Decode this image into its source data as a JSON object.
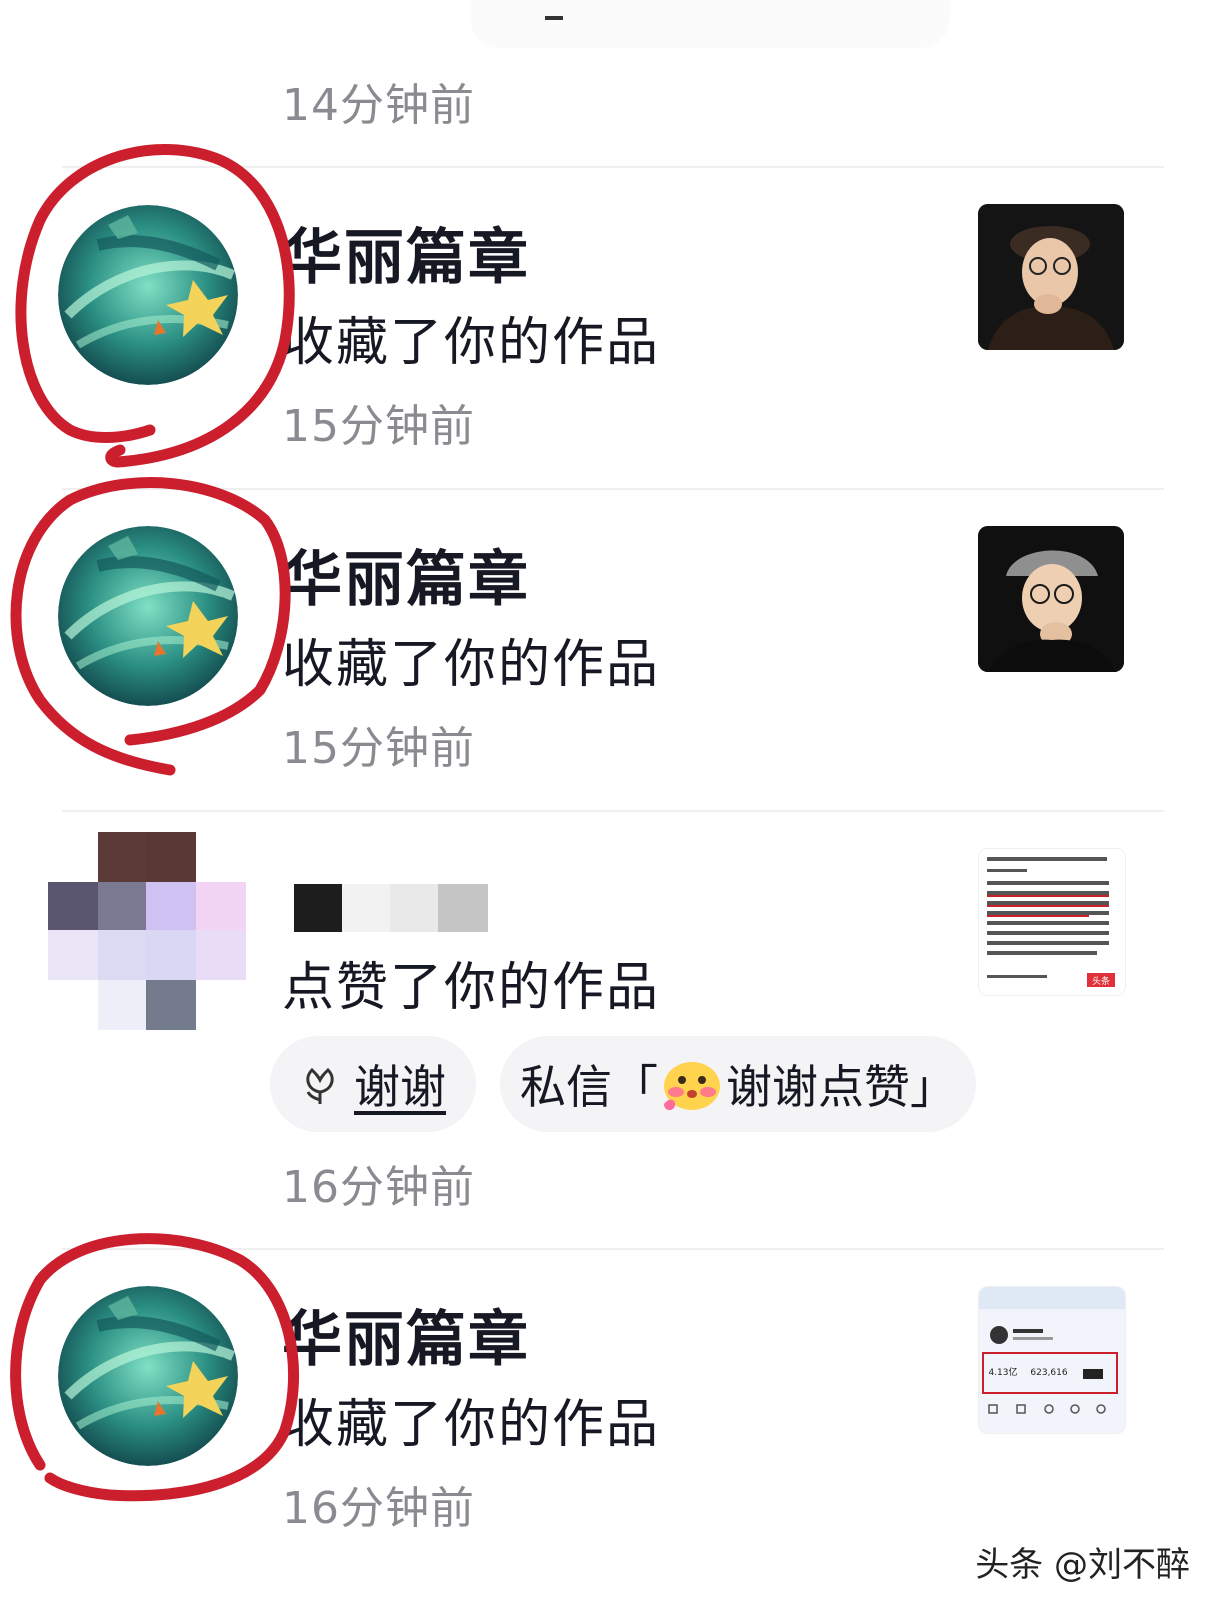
{
  "notifications": [
    {
      "time": "14分钟前"
    },
    {
      "user": "华丽篇章",
      "action": "收藏了你的作品",
      "time": "15分钟前",
      "avatar_icon": "game-emblem-avatar-icon",
      "thumb_icon": "man-portrait-thumbnail"
    },
    {
      "user": "华丽篇章",
      "action": "收藏了你的作品",
      "time": "15分钟前",
      "avatar_icon": "game-emblem-avatar-icon",
      "thumb_icon": "man-portrait-thumbnail"
    },
    {
      "user": "",
      "action": "点赞了你的作品",
      "time": "16分钟前",
      "avatar_icon": "pixelated-avatar",
      "thumb_icon": "article-screenshot-thumbnail",
      "thumb_badge": "头条",
      "buttons": {
        "thanks": "谢谢",
        "dm_prefix": "私信「",
        "dm_text": "谢谢点赞」"
      }
    },
    {
      "user": "华丽篇章",
      "action": "收藏了你的作品",
      "time": "16分钟前",
      "avatar_icon": "game-emblem-avatar-icon",
      "thumb_icon": "profile-stats-screenshot-thumbnail",
      "thumb_stats": [
        "4.13亿",
        "623,616"
      ]
    }
  ],
  "annotation_color": "#cc1f2e",
  "watermark": "头条 @刘不醉"
}
